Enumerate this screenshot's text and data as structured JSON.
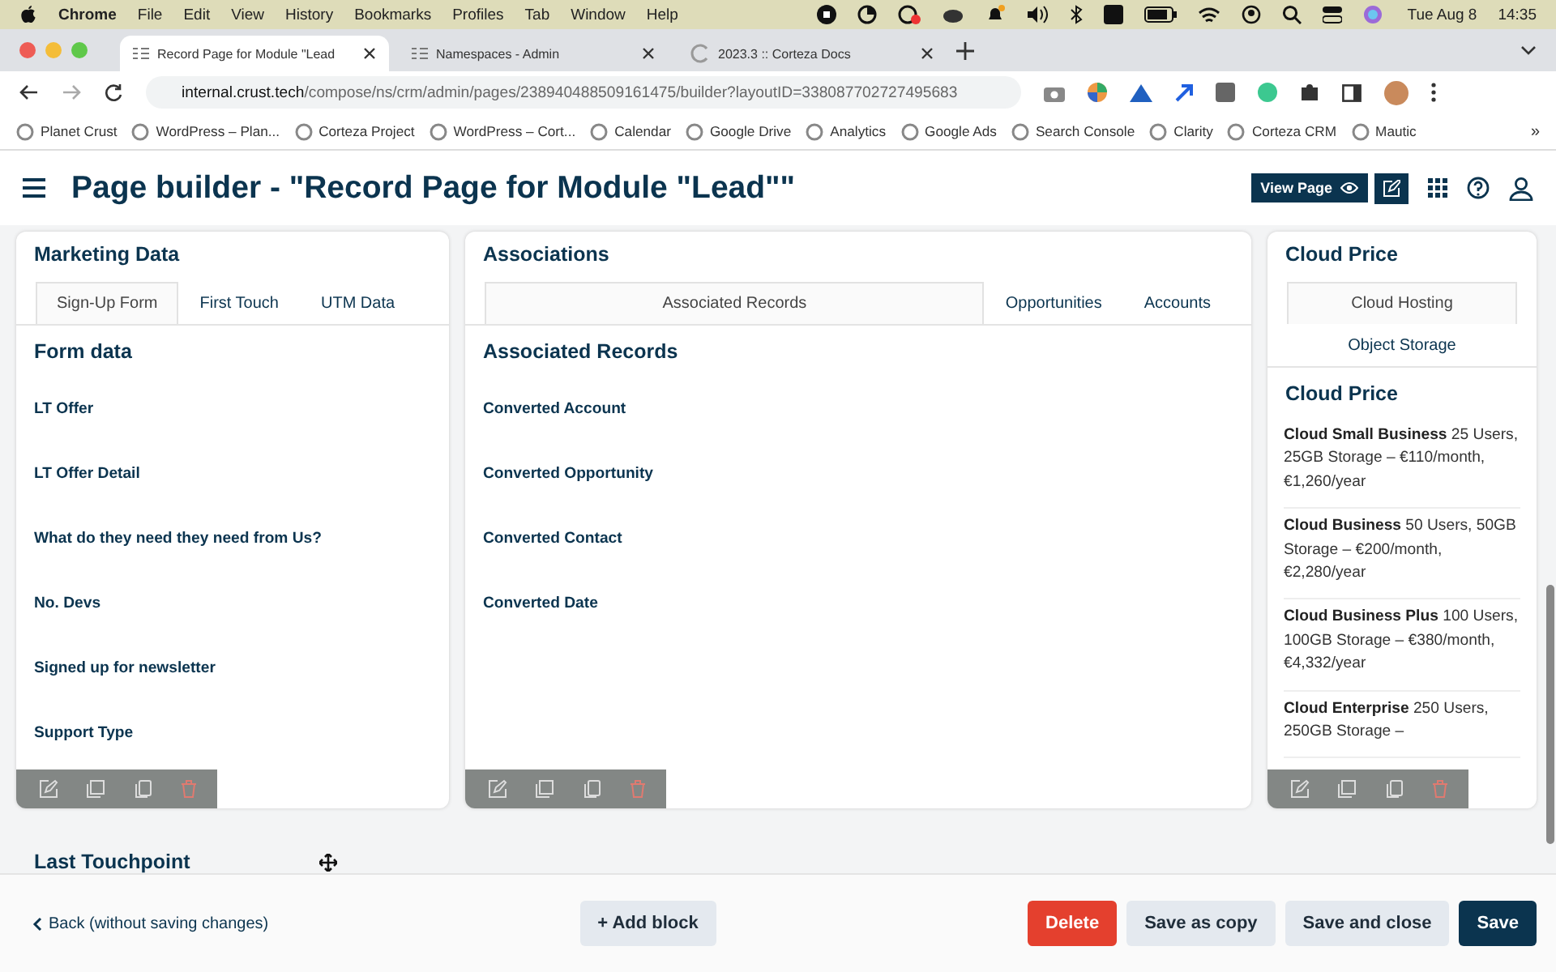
{
  "menubar": {
    "app": "Chrome",
    "menus": [
      "File",
      "Edit",
      "View",
      "History",
      "Bookmarks",
      "Profiles",
      "Tab",
      "Window",
      "Help"
    ],
    "date": "Tue Aug 8",
    "time": "14:35"
  },
  "browser": {
    "tabs": [
      {
        "title": "Record Page for Module \"Lead",
        "selected": true
      },
      {
        "title": "Namespaces - Admin",
        "selected": false
      },
      {
        "title": "2023.3 :: Corteza Docs",
        "selected": false
      }
    ],
    "url_host": "internal.crust.tech",
    "url_path": "/compose/ns/crm/admin/pages/238940488509161475/builder?layoutID=338087702727495683",
    "bookmarks": [
      "Planet Crust",
      "WordPress – Plan...",
      "Corteza Project",
      "WordPress – Cort...",
      "Calendar",
      "Google Drive",
      "Analytics",
      "Google Ads",
      "Search Console",
      "Clarity",
      "Corteza CRM",
      "Mautic"
    ],
    "bookmarks_more": "»"
  },
  "header": {
    "title": "Page builder - \"Record Page for Module \"Lead\"\"",
    "view_button": "View Page"
  },
  "blocks": [
    {
      "title": "Marketing Data",
      "tabs": [
        {
          "label": "Sign-Up Form",
          "selected": true
        },
        {
          "label": "First Touch",
          "selected": false
        },
        {
          "label": "UTM Data",
          "selected": false
        }
      ],
      "section": "Form data",
      "fields": [
        "LT Offer",
        "LT Offer Detail",
        "What do they need they need from Us?",
        "No. Devs",
        "Signed up for newsletter",
        "Support Type"
      ]
    },
    {
      "title": "Associations",
      "tabs": [
        {
          "label": "Associated Records",
          "selected": true
        },
        {
          "label": "Opportunities",
          "selected": false
        },
        {
          "label": "Accounts",
          "selected": false
        }
      ],
      "section": "Associated Records",
      "fields": [
        "Converted Account",
        "Converted Opportunity",
        "Converted Contact",
        "Converted Date"
      ]
    },
    {
      "title": "Cloud Price",
      "tabs": [
        {
          "label": "Cloud Hosting",
          "selected": true
        },
        {
          "label": "Object Storage",
          "selected": false
        }
      ],
      "section": "Cloud Price",
      "items": [
        {
          "text": "**Cloud Small Business** 25 Users, 25GB Storage – €110/month,  €1,260/year"
        },
        {
          "text": "**Cloud Business** 50 Users, 50GB Storage – €200/month, €2,280/year"
        },
        {
          "text": "**Cloud Business Plus** 100 Users, 100GB Storage – €380/month, €4,332/year"
        },
        {
          "text": "**Cloud Enterprise** 250 Users, 250GB Storage –"
        }
      ]
    }
  ],
  "last_block": {
    "title": "Last Touchpoint"
  },
  "footer": {
    "back": "Back (without saving changes)",
    "add_block": "+ Add block",
    "buttons": [
      {
        "label": "Delete",
        "kind": "danger"
      },
      {
        "label": "Save as copy",
        "kind": "secondary"
      },
      {
        "label": "Save and close",
        "kind": "secondary"
      },
      {
        "label": "Save",
        "kind": "primary"
      }
    ]
  }
}
